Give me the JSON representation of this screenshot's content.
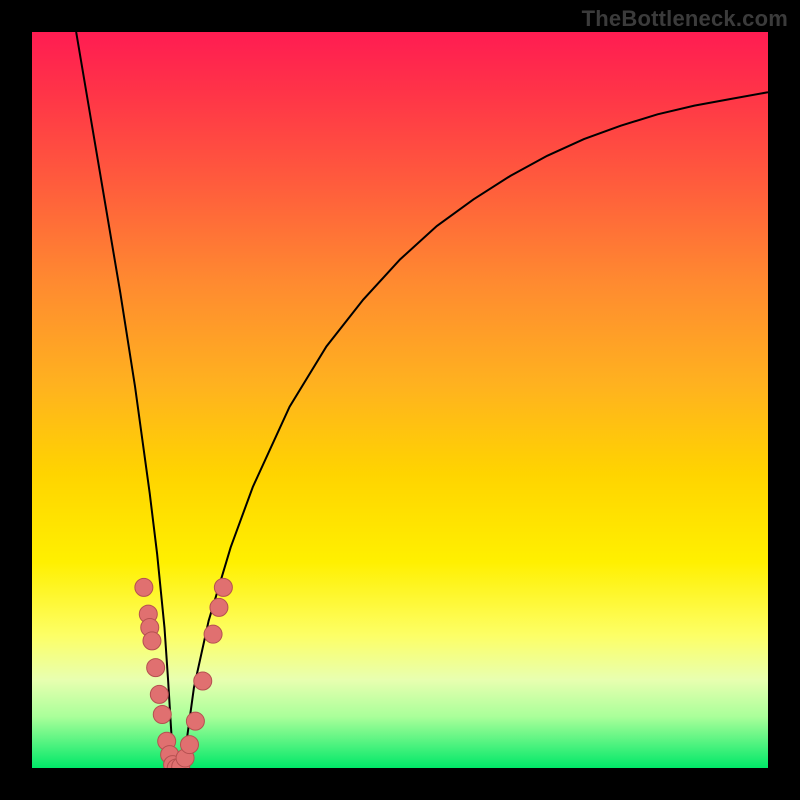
{
  "watermark": "TheBottleneck.com",
  "colors": {
    "frame": "#000000",
    "curve_stroke": "#000000",
    "marker_fill": "#e07070",
    "marker_stroke": "#b55050",
    "gradient_top": "#ff1c52",
    "gradient_bottom": "#00e868"
  },
  "chart_data": {
    "type": "line",
    "title": "",
    "xlabel": "",
    "ylabel": "",
    "xlim": [
      0,
      100
    ],
    "ylim": [
      0,
      110
    ],
    "series": [
      {
        "name": "bottleneck-curve",
        "x": [
          6,
          8,
          10,
          12,
          14,
          15,
          16,
          17,
          18,
          18.5,
          19,
          20,
          21,
          22,
          24,
          27,
          30,
          35,
          40,
          45,
          50,
          55,
          60,
          65,
          70,
          75,
          80,
          85,
          90,
          95,
          100
        ],
        "y": [
          110,
          97,
          84,
          71,
          57,
          49,
          41,
          32,
          21,
          13,
          4,
          0,
          4,
          12,
          22,
          33,
          42,
          54,
          63,
          70,
          76,
          81,
          85,
          88.5,
          91.5,
          94,
          96,
          97.7,
          99,
          100,
          101
        ]
      }
    ],
    "markers": [
      {
        "x": 15.2,
        "y": 27
      },
      {
        "x": 15.8,
        "y": 23
      },
      {
        "x": 16.0,
        "y": 21
      },
      {
        "x": 16.3,
        "y": 19
      },
      {
        "x": 16.8,
        "y": 15
      },
      {
        "x": 17.3,
        "y": 11
      },
      {
        "x": 17.7,
        "y": 8
      },
      {
        "x": 18.3,
        "y": 4
      },
      {
        "x": 18.7,
        "y": 2
      },
      {
        "x": 19.1,
        "y": 0.5
      },
      {
        "x": 19.6,
        "y": 0
      },
      {
        "x": 20.2,
        "y": 0.2
      },
      {
        "x": 20.8,
        "y": 1.5
      },
      {
        "x": 21.4,
        "y": 3.5
      },
      {
        "x": 22.2,
        "y": 7
      },
      {
        "x": 23.2,
        "y": 13
      },
      {
        "x": 24.6,
        "y": 20
      },
      {
        "x": 25.4,
        "y": 24
      },
      {
        "x": 26.0,
        "y": 27
      }
    ]
  }
}
